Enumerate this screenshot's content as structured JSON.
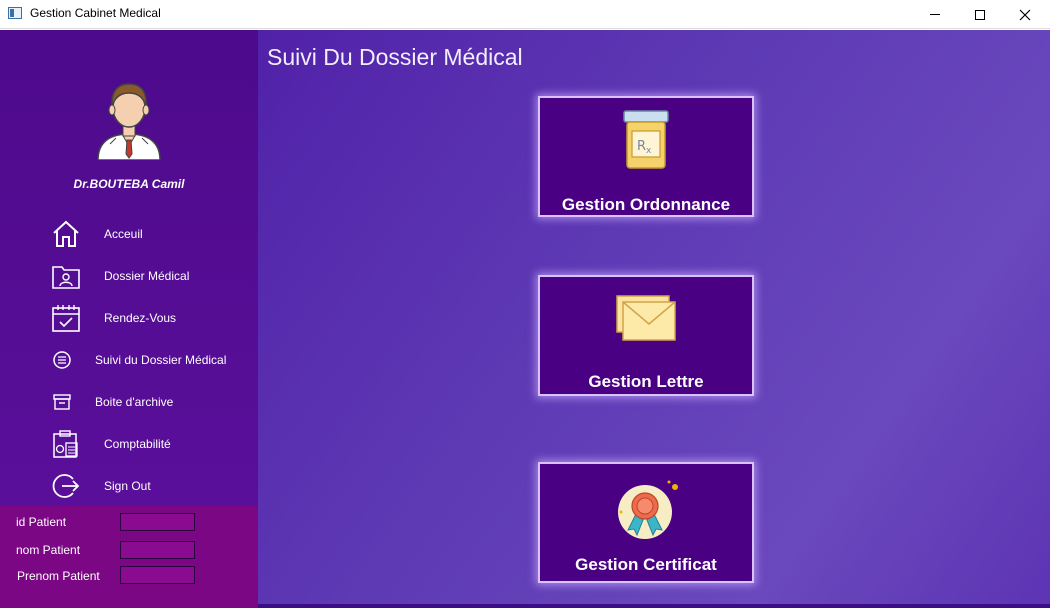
{
  "window": {
    "title": "Gestion Cabinet Medical"
  },
  "sidebar": {
    "doctor_name": "Dr.BOUTEBA Camil",
    "items": [
      {
        "label": "Acceuil",
        "icon": "home-icon"
      },
      {
        "label": "Dossier Médical",
        "icon": "folder-user-icon"
      },
      {
        "label": "Rendez-Vous",
        "icon": "calendar-check-icon"
      },
      {
        "label": "Suivi du Dossier Médical",
        "icon": "list-circle-icon"
      },
      {
        "label": "Boite d'archive",
        "icon": "archive-box-icon"
      },
      {
        "label": "Comptabilité",
        "icon": "accounting-icon"
      },
      {
        "label": "Sign Out",
        "icon": "sign-out-icon"
      }
    ]
  },
  "patient": {
    "id_label": "id Patient",
    "id_value": "",
    "nom_label": "nom Patient",
    "nom_value": "",
    "prenom_label": "Prenom Patient",
    "prenom_value": ""
  },
  "main": {
    "title": "Suivi Du Dossier Médical",
    "cards": [
      {
        "label": "Gestion Ordonnance",
        "icon": "prescription-jar-icon"
      },
      {
        "label": "Gestion Lettre",
        "icon": "envelope-icon"
      },
      {
        "label": "Gestion Certificat",
        "icon": "award-badge-icon"
      }
    ]
  },
  "colors": {
    "sidebar": "#4d0a8c",
    "patient_panel": "#7c0784",
    "card": "#4a0083",
    "main_gradient_start": "#5121a8",
    "main_gradient_end": "#6a48bd"
  }
}
